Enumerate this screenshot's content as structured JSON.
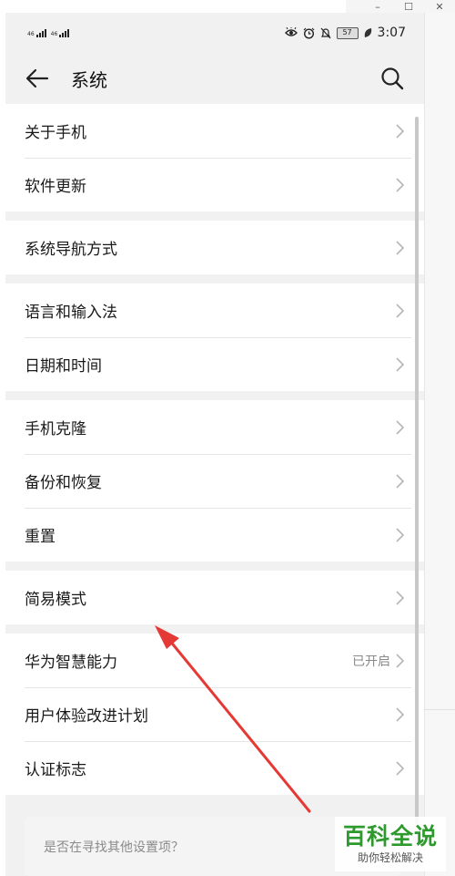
{
  "window": {
    "controls": [
      "–",
      "☐",
      "✕"
    ]
  },
  "status_bar": {
    "signal_1": "46",
    "signal_2": "46",
    "battery": "57",
    "time": "3:07"
  },
  "header": {
    "title": "系统"
  },
  "groups": [
    [
      {
        "label": "关于手机"
      },
      {
        "label": "软件更新"
      }
    ],
    [
      {
        "label": "系统导航方式"
      }
    ],
    [
      {
        "label": "语言和输入法"
      },
      {
        "label": "日期和时间"
      }
    ],
    [
      {
        "label": "手机克隆"
      },
      {
        "label": "备份和恢复"
      },
      {
        "label": "重置"
      }
    ],
    [
      {
        "label": "简易模式"
      }
    ],
    [
      {
        "label": "华为智慧能力",
        "status": "已开启"
      },
      {
        "label": "用户体验改进计划"
      },
      {
        "label": "认证标志"
      }
    ]
  ],
  "hint": {
    "text": "是否在寻找其他设置项？"
  },
  "watermark": {
    "main": "百科全说",
    "sub": "助你轻松解决"
  },
  "colors": {
    "annotation_arrow": "#e53935",
    "watermark_green": "#2e9a2e"
  }
}
